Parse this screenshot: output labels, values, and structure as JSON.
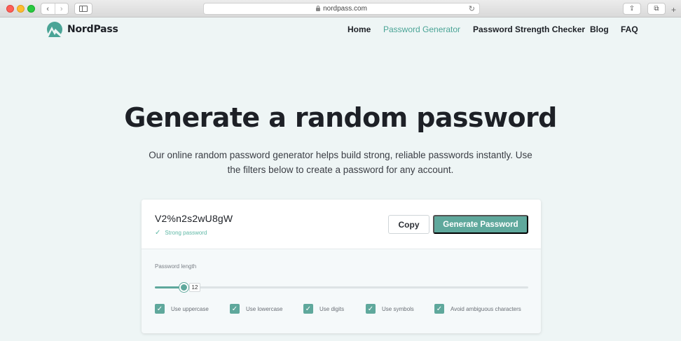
{
  "browser": {
    "url": "nordpass.com",
    "back_icon": "‹",
    "forward_icon": "›",
    "reload_icon": "↻",
    "share_icon": "⇪",
    "tabs_icon": "⧉",
    "newtab_icon": "+"
  },
  "header": {
    "logo_text": "NordPass",
    "nav": [
      {
        "label": "Home",
        "active": false
      },
      {
        "label": "Password Generator",
        "active": true
      },
      {
        "label": "Password Strength Checker",
        "active": false
      },
      {
        "label": "Blog",
        "active": false
      },
      {
        "label": "FAQ",
        "active": false
      }
    ]
  },
  "hero": {
    "title": "Generate a random password",
    "subtitle_line1": "Our online random password generator helps build strong, reliable passwords instantly. Use",
    "subtitle_line2": "the filters below to create a password for any account."
  },
  "generator": {
    "password": "V2%n2s2wU8gW",
    "strength": "Strong password",
    "copy_label": "Copy",
    "generate_label": "Generate Password",
    "length_label": "Password length",
    "length_value": "12",
    "length_fraction": 0.077,
    "options": [
      {
        "label": "Use uppercase",
        "checked": true
      },
      {
        "label": "Use lowercase",
        "checked": true
      },
      {
        "label": "Use digits",
        "checked": true
      },
      {
        "label": "Use symbols",
        "checked": true
      },
      {
        "label": "Avoid ambiguous characters",
        "checked": true
      }
    ]
  },
  "colors": {
    "accent": "#5fa89c",
    "page_bg": "#eef5f5",
    "text": "#1d2026"
  }
}
